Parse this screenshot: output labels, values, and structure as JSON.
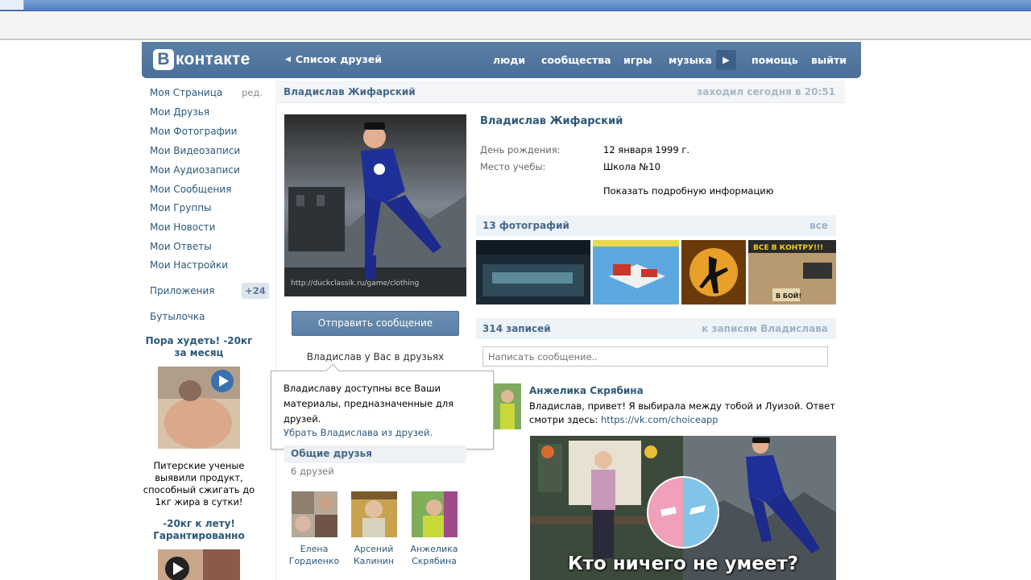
{
  "header": {
    "logo_letter": "В",
    "logo_text": "контакте",
    "back_link": "Список друзей",
    "nav": [
      "люди",
      "сообщества",
      "игры",
      "музыка",
      "помощь",
      "выйти"
    ]
  },
  "left_menu": {
    "items": [
      "Моя Страница",
      "Мои Друзья",
      "Мои Фотографии",
      "Мои Видеозаписи",
      "Мои Аудиозаписи",
      "Мои Сообщения",
      "Мои Группы",
      "Мои Новости",
      "Мои Ответы",
      "Мои Настройки"
    ],
    "edit_label": "ред.",
    "apps_label": "Приложения",
    "apps_badge": "+24",
    "extra_item": "Бутылочка"
  },
  "ads": [
    {
      "title": "Пора худеть! -20кг за месяц",
      "text": "Питерские ученые выявили продукт, способный сжигать до 1кг жира в сутки!"
    },
    {
      "title": "-20кг к лету! Гарантированно"
    }
  ],
  "page_head": {
    "name": "Владислав Жифарский",
    "status": "заходил сегодня в 20:51"
  },
  "profile": {
    "avatar_watermark": "http://duckclassik.ru/game/clothing",
    "send_button": "Отправить сообщение",
    "friend_status": "Владислав у Вас в друзьях",
    "popup_text": "Владиславу доступны все Ваши материалы, предназначенные для друзей.",
    "popup_link": "Убрать Владислава из друзей.",
    "name": "Владислав Жифарский",
    "info": [
      {
        "label": "День рождения:",
        "value": "12 января 1999 г."
      },
      {
        "label": "Место учебы:",
        "value": "Школа №10"
      }
    ],
    "more_info": "Показать подробную информацию"
  },
  "common_friends": {
    "title": "Общие друзья",
    "count": "6 друзей",
    "friends": [
      {
        "first": "Елена",
        "last": "Гордиенко"
      },
      {
        "first": "Арсений",
        "last": "Калинин"
      },
      {
        "first": "Анжелика",
        "last": "Скрябина"
      }
    ]
  },
  "photos": {
    "title": "13 фотографий",
    "link": "все",
    "photo4_banner": "ВСЕ В КОНТРУ!!!",
    "photo4_button": "В БОЙ!"
  },
  "wall": {
    "title": "314 записей",
    "link": "к записям Владислава",
    "input_placeholder": "Написать сообщение..",
    "post": {
      "author": "Анжелика Скрябина",
      "text": "Владислав, привет! Я выбирала между тобой и Луизой. Ответ смотри здесь:",
      "link": "https://vk.com/choiceapp",
      "image_caption": "Кто ничего не умеет?"
    }
  },
  "colors": {
    "header_bg": "#4a6f98",
    "link": "#2b587a",
    "section_bg": "#eef3f8"
  }
}
